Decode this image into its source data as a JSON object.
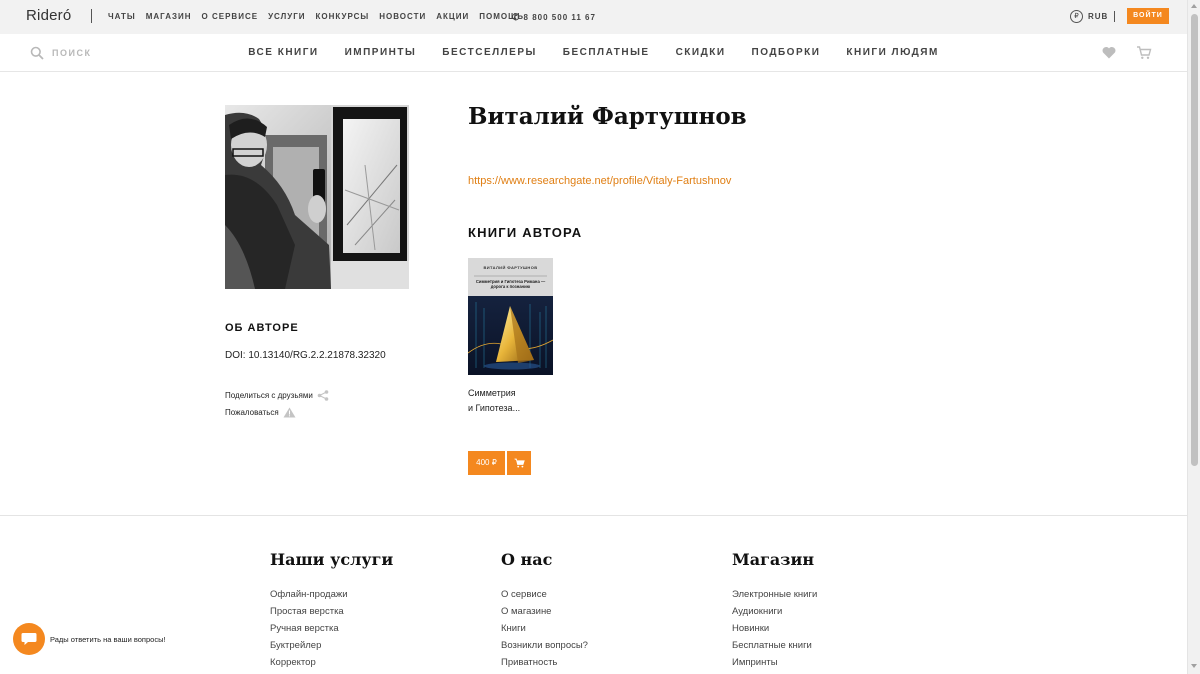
{
  "topbar": {
    "logo": "Rideró",
    "nav": [
      "ЧАТЫ",
      "МАГАЗИН",
      "О СЕРВИСЕ",
      "УСЛУГИ",
      "КОНКУРСЫ",
      "НОВОСТИ",
      "АКЦИИ",
      "ПОМОЩЬ"
    ],
    "phone": "8 800 500 11 67",
    "currency_symbol": "₽",
    "currency": "RUB",
    "login_label": "ВОЙТИ"
  },
  "mainnav": {
    "search_label": "ПОИСК",
    "items": [
      "ВСЕ КНИГИ",
      "ИМПРИНТЫ",
      "БЕСТСЕЛЛЕРЫ",
      "БЕСПЛАТНЫЕ",
      "СКИДКИ",
      "ПОДБОРКИ",
      "КНИГИ ЛЮДЯМ"
    ]
  },
  "author": {
    "name": "Виталий Фартушнов",
    "link": "https://www.researchgate.net/profile/Vitaly-Fartushnov",
    "about_title": "ОБ АВТОРЕ",
    "about_text": "DOI: 10.13140/RG.2.2.21878.32320",
    "share_label": "Поделиться с друзьями",
    "complain_label": "Пожаловаться"
  },
  "books": {
    "section_title": "КНИГИ АВТОРА",
    "items": [
      {
        "cover_author": "ВИТАЛИЙ ФАРТУШНОВ",
        "cover_title": "Симметрия и Гипотеза Римана — дорога к познанию",
        "title_line1": "Симметрия",
        "title_line2": "и Гипотеза...",
        "price": "400 ₽"
      }
    ]
  },
  "footer": {
    "columns": [
      {
        "title": "Наши услуги",
        "items": [
          "Офлайн-продажи",
          "Простая верстка",
          "Ручная верстка",
          "Буктрейлер",
          "Корректор"
        ]
      },
      {
        "title": "О нас",
        "items": [
          "О сервисе",
          "О магазине",
          "Книги",
          "Возникли вопросы?",
          "Приватность"
        ]
      },
      {
        "title": "Магазин",
        "items": [
          "Электронные книги",
          "Аудиокниги",
          "Новинки",
          "Бесплатные книги",
          "Импринты"
        ]
      }
    ]
  },
  "chat": {
    "text": "Рады ответить на ваши вопросы!"
  },
  "colors": {
    "accent": "#f4881f",
    "link": "#e07f14"
  }
}
